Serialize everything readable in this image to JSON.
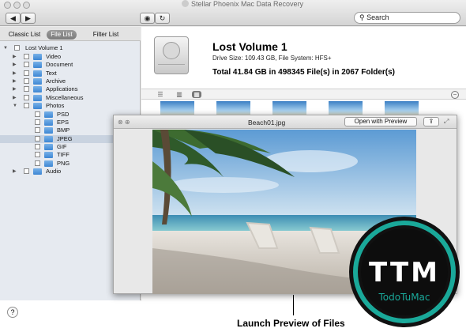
{
  "window": {
    "title": "Stellar Phoenix Mac Data Recovery"
  },
  "toolbar": {
    "back": "◀",
    "forward": "▶",
    "preview_eye": "👁",
    "refresh": "↻",
    "search_placeholder": "Search"
  },
  "sidebar": {
    "tabs": [
      "Classic List",
      "File List",
      "Filter List"
    ],
    "selected_tab": "File List",
    "tree": [
      {
        "label": "Lost Volume 1",
        "level": 0,
        "expanded": true
      },
      {
        "label": "Video",
        "level": 1
      },
      {
        "label": "Document",
        "level": 1
      },
      {
        "label": "Text",
        "level": 1
      },
      {
        "label": "Archive",
        "level": 1
      },
      {
        "label": "Applications",
        "level": 1
      },
      {
        "label": "Miscellaneous",
        "level": 1
      },
      {
        "label": "Photos",
        "level": 1,
        "expanded": true
      },
      {
        "label": "PSD",
        "level": 2
      },
      {
        "label": "EPS",
        "level": 2
      },
      {
        "label": "BMP",
        "level": 2
      },
      {
        "label": "JPEG",
        "level": 2,
        "selected": true
      },
      {
        "label": "GIF",
        "level": 2
      },
      {
        "label": "TIFF",
        "level": 2
      },
      {
        "label": "PNG",
        "level": 2
      },
      {
        "label": "Audio",
        "level": 1
      }
    ],
    "help": "?"
  },
  "volume": {
    "name": "Lost Volume 1",
    "info": "Drive Size: 109.43 GB, File System: HFS+",
    "total": "Total 41.84 GB in 498345 File(s) in 2067 Folder(s)"
  },
  "preview": {
    "title": "Beach01.jpg",
    "open_button": "Open with Preview",
    "share_icon": "share-icon",
    "expand_icon": "expand-icon"
  },
  "caption": "Launch Preview of Files",
  "logo": {
    "initials": "TTM",
    "name": "TodoTuMac",
    "accent": "#1aa99a"
  }
}
